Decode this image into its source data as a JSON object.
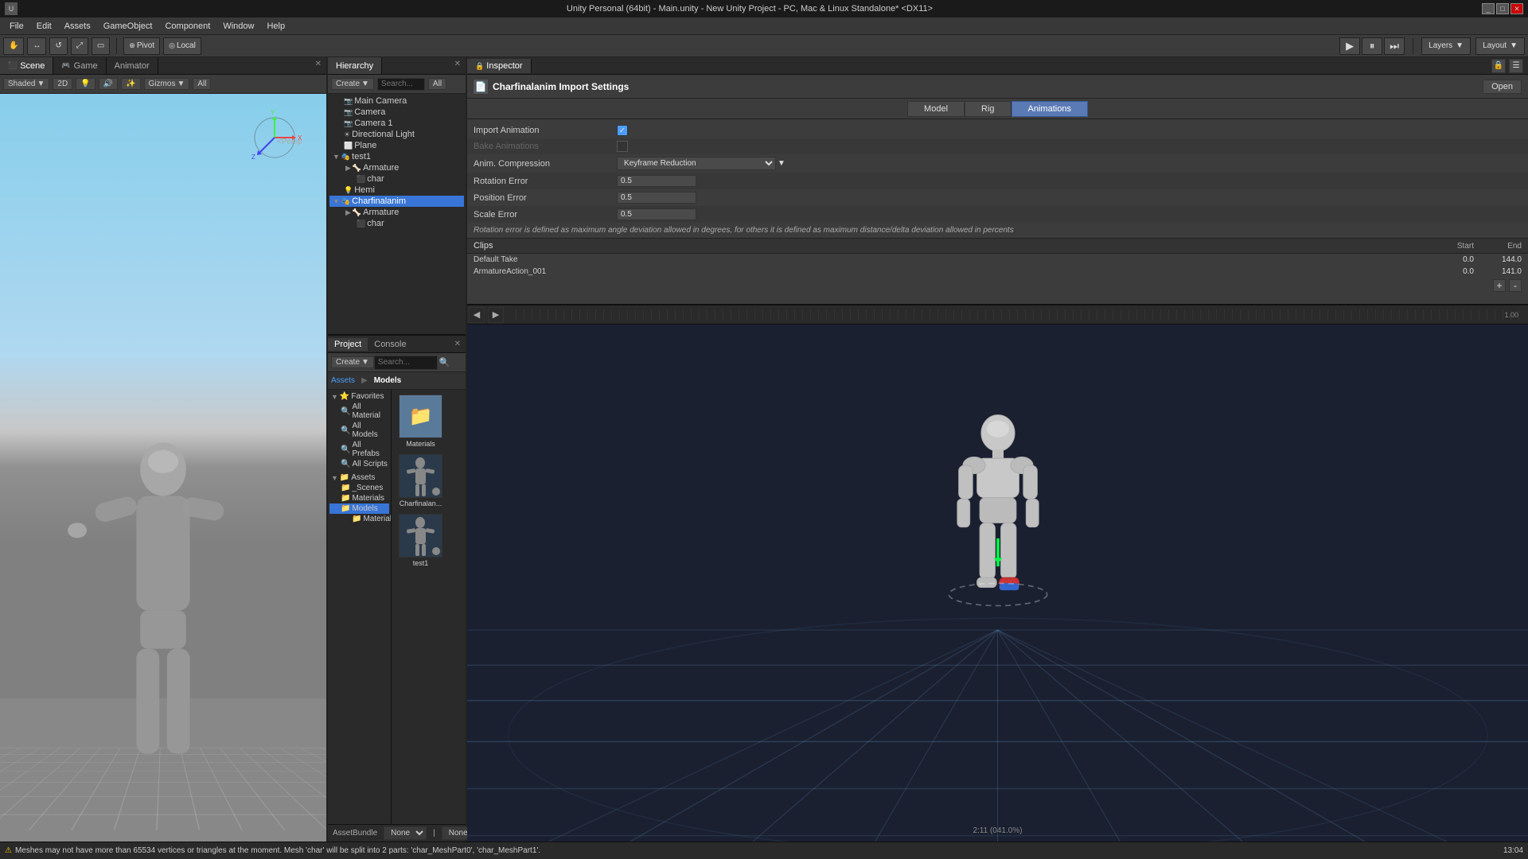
{
  "titlebar": {
    "title": "Unity Personal (64bit) - Main.unity - New Unity Project - PC, Mac & Linux Standalone* <DX11>",
    "controls": [
      "_",
      "□",
      "✕"
    ]
  },
  "menubar": {
    "items": [
      "File",
      "Edit",
      "Assets",
      "GameObject",
      "Component",
      "Window",
      "Help"
    ]
  },
  "toolbar": {
    "tools": [
      "⟳",
      "↔",
      "↕",
      "⟳",
      "⤢"
    ],
    "pivot_label": "Pivot",
    "local_label": "Local",
    "play": "▶",
    "pause": "⏸",
    "step": "⏭",
    "layers_label": "Layers",
    "layout_label": "Layout"
  },
  "left_panel": {
    "tabs": [
      "Scene",
      "Game",
      "Animator"
    ],
    "active_tab": "Scene",
    "shading": "Shaded",
    "mode": "2D",
    "gizmos": "Gizmos",
    "gizmos_all": "All",
    "persp_label": "<Persp"
  },
  "hierarchy": {
    "title": "Hierarchy",
    "create_label": "Create",
    "all_label": "All",
    "items": [
      {
        "label": "Main Camera",
        "indent": 0,
        "expanded": false
      },
      {
        "label": "Camera",
        "indent": 0,
        "expanded": false
      },
      {
        "label": "Camera 1",
        "indent": 0,
        "expanded": false
      },
      {
        "label": "Directional Light",
        "indent": 0,
        "expanded": false
      },
      {
        "label": "Plane",
        "indent": 0,
        "expanded": false
      },
      {
        "label": "test1",
        "indent": 0,
        "expanded": true
      },
      {
        "label": "Armature",
        "indent": 1,
        "expanded": false
      },
      {
        "label": "char",
        "indent": 1,
        "expanded": false
      },
      {
        "label": "Hemi",
        "indent": 0,
        "expanded": false
      },
      {
        "label": "Charfinalanim",
        "indent": 0,
        "expanded": true,
        "selected": true
      },
      {
        "label": "Armature",
        "indent": 1,
        "expanded": false
      },
      {
        "label": "char",
        "indent": 1,
        "expanded": false
      }
    ]
  },
  "project": {
    "tabs": [
      "Project",
      "Console"
    ],
    "active_tab": "Project",
    "create_label": "Create",
    "nav": [
      "Assets",
      "Models"
    ],
    "favorites": {
      "label": "Favorites",
      "items": [
        "All Material",
        "All Models",
        "All Prefabs",
        "All Scripts"
      ]
    },
    "assets": {
      "label": "Assets",
      "folders": [
        "_Scenes",
        "Materials",
        "Models",
        "Materials"
      ]
    },
    "files": [
      {
        "label": "Materials",
        "type": "folder"
      },
      {
        "label": "Charfinalan...",
        "type": "model"
      },
      {
        "label": "test1",
        "type": "model"
      }
    ]
  },
  "inspector": {
    "tab_label": "Inspector",
    "title": "Charfinalanim Import Settings",
    "open_label": "Open",
    "model_tabs": [
      "Model",
      "Rig",
      "Animations"
    ],
    "active_model_tab": "Animations",
    "import_animation": {
      "label": "Import Animation",
      "checked": true
    },
    "bake_animations": {
      "label": "Bake Animations",
      "checked": false
    },
    "anim_compression": {
      "label": "Anim. Compression",
      "value": "Keyframe Reduction"
    },
    "rotation_error": {
      "label": "Rotation Error",
      "value": "0.5"
    },
    "position_error": {
      "label": "Position Error",
      "value": "0.5"
    },
    "scale_error": {
      "label": "Scale Error",
      "value": "0.5"
    },
    "info_text": "Rotation error is defined as maximum angle deviation allowed in degrees, for others it is defined as maximum distance/delta deviation allowed in percents",
    "clips": {
      "label": "Clips",
      "start_col": "Start",
      "end_col": "End",
      "items": [
        {
          "name": "Default Take",
          "start": "0.0",
          "end": "144.0"
        },
        {
          "name": "ArmatureAction_001",
          "start": "0.0",
          "end": "141.0"
        }
      ]
    },
    "add_label": "+",
    "remove_label": "-",
    "timeline_value": "1.00"
  },
  "anim_preview": {
    "play_label": "▶",
    "coord": "2:11 (041.0%)"
  },
  "asset_bundle": {
    "label": "AssetBundle",
    "value": "None",
    "second_value": "None"
  },
  "statusbar": {
    "warning_icon": "⚠",
    "message": "Meshes may not have more than 65534 vertices or triangles at the moment. Mesh 'char' will be split into 2 parts: 'char_MeshPart0', 'char_MeshPart1'."
  },
  "taskbar": {
    "time": "13:04"
  }
}
